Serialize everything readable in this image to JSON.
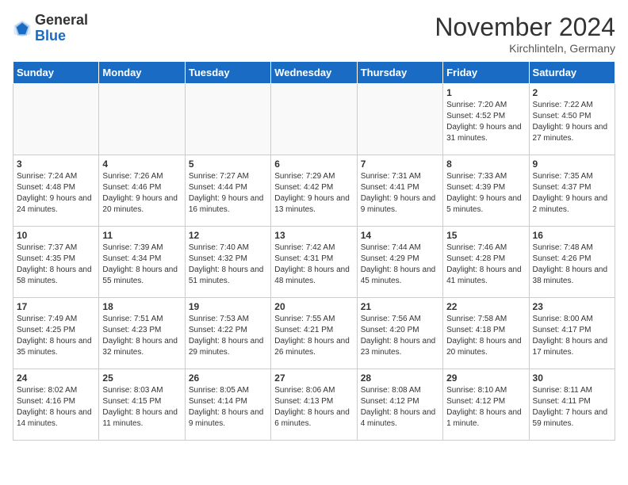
{
  "header": {
    "logo_general": "General",
    "logo_blue": "Blue",
    "month_title": "November 2024",
    "location": "Kirchlinteln, Germany"
  },
  "weekdays": [
    "Sunday",
    "Monday",
    "Tuesday",
    "Wednesday",
    "Thursday",
    "Friday",
    "Saturday"
  ],
  "weeks": [
    [
      {
        "day": "",
        "sunrise": "",
        "sunset": "",
        "daylight": ""
      },
      {
        "day": "",
        "sunrise": "",
        "sunset": "",
        "daylight": ""
      },
      {
        "day": "",
        "sunrise": "",
        "sunset": "",
        "daylight": ""
      },
      {
        "day": "",
        "sunrise": "",
        "sunset": "",
        "daylight": ""
      },
      {
        "day": "",
        "sunrise": "",
        "sunset": "",
        "daylight": ""
      },
      {
        "day": "1",
        "sunrise": "Sunrise: 7:20 AM",
        "sunset": "Sunset: 4:52 PM",
        "daylight": "Daylight: 9 hours and 31 minutes."
      },
      {
        "day": "2",
        "sunrise": "Sunrise: 7:22 AM",
        "sunset": "Sunset: 4:50 PM",
        "daylight": "Daylight: 9 hours and 27 minutes."
      }
    ],
    [
      {
        "day": "3",
        "sunrise": "Sunrise: 7:24 AM",
        "sunset": "Sunset: 4:48 PM",
        "daylight": "Daylight: 9 hours and 24 minutes."
      },
      {
        "day": "4",
        "sunrise": "Sunrise: 7:26 AM",
        "sunset": "Sunset: 4:46 PM",
        "daylight": "Daylight: 9 hours and 20 minutes."
      },
      {
        "day": "5",
        "sunrise": "Sunrise: 7:27 AM",
        "sunset": "Sunset: 4:44 PM",
        "daylight": "Daylight: 9 hours and 16 minutes."
      },
      {
        "day": "6",
        "sunrise": "Sunrise: 7:29 AM",
        "sunset": "Sunset: 4:42 PM",
        "daylight": "Daylight: 9 hours and 13 minutes."
      },
      {
        "day": "7",
        "sunrise": "Sunrise: 7:31 AM",
        "sunset": "Sunset: 4:41 PM",
        "daylight": "Daylight: 9 hours and 9 minutes."
      },
      {
        "day": "8",
        "sunrise": "Sunrise: 7:33 AM",
        "sunset": "Sunset: 4:39 PM",
        "daylight": "Daylight: 9 hours and 5 minutes."
      },
      {
        "day": "9",
        "sunrise": "Sunrise: 7:35 AM",
        "sunset": "Sunset: 4:37 PM",
        "daylight": "Daylight: 9 hours and 2 minutes."
      }
    ],
    [
      {
        "day": "10",
        "sunrise": "Sunrise: 7:37 AM",
        "sunset": "Sunset: 4:35 PM",
        "daylight": "Daylight: 8 hours and 58 minutes."
      },
      {
        "day": "11",
        "sunrise": "Sunrise: 7:39 AM",
        "sunset": "Sunset: 4:34 PM",
        "daylight": "Daylight: 8 hours and 55 minutes."
      },
      {
        "day": "12",
        "sunrise": "Sunrise: 7:40 AM",
        "sunset": "Sunset: 4:32 PM",
        "daylight": "Daylight: 8 hours and 51 minutes."
      },
      {
        "day": "13",
        "sunrise": "Sunrise: 7:42 AM",
        "sunset": "Sunset: 4:31 PM",
        "daylight": "Daylight: 8 hours and 48 minutes."
      },
      {
        "day": "14",
        "sunrise": "Sunrise: 7:44 AM",
        "sunset": "Sunset: 4:29 PM",
        "daylight": "Daylight: 8 hours and 45 minutes."
      },
      {
        "day": "15",
        "sunrise": "Sunrise: 7:46 AM",
        "sunset": "Sunset: 4:28 PM",
        "daylight": "Daylight: 8 hours and 41 minutes."
      },
      {
        "day": "16",
        "sunrise": "Sunrise: 7:48 AM",
        "sunset": "Sunset: 4:26 PM",
        "daylight": "Daylight: 8 hours and 38 minutes."
      }
    ],
    [
      {
        "day": "17",
        "sunrise": "Sunrise: 7:49 AM",
        "sunset": "Sunset: 4:25 PM",
        "daylight": "Daylight: 8 hours and 35 minutes."
      },
      {
        "day": "18",
        "sunrise": "Sunrise: 7:51 AM",
        "sunset": "Sunset: 4:23 PM",
        "daylight": "Daylight: 8 hours and 32 minutes."
      },
      {
        "day": "19",
        "sunrise": "Sunrise: 7:53 AM",
        "sunset": "Sunset: 4:22 PM",
        "daylight": "Daylight: 8 hours and 29 minutes."
      },
      {
        "day": "20",
        "sunrise": "Sunrise: 7:55 AM",
        "sunset": "Sunset: 4:21 PM",
        "daylight": "Daylight: 8 hours and 26 minutes."
      },
      {
        "day": "21",
        "sunrise": "Sunrise: 7:56 AM",
        "sunset": "Sunset: 4:20 PM",
        "daylight": "Daylight: 8 hours and 23 minutes."
      },
      {
        "day": "22",
        "sunrise": "Sunrise: 7:58 AM",
        "sunset": "Sunset: 4:18 PM",
        "daylight": "Daylight: 8 hours and 20 minutes."
      },
      {
        "day": "23",
        "sunrise": "Sunrise: 8:00 AM",
        "sunset": "Sunset: 4:17 PM",
        "daylight": "Daylight: 8 hours and 17 minutes."
      }
    ],
    [
      {
        "day": "24",
        "sunrise": "Sunrise: 8:02 AM",
        "sunset": "Sunset: 4:16 PM",
        "daylight": "Daylight: 8 hours and 14 minutes."
      },
      {
        "day": "25",
        "sunrise": "Sunrise: 8:03 AM",
        "sunset": "Sunset: 4:15 PM",
        "daylight": "Daylight: 8 hours and 11 minutes."
      },
      {
        "day": "26",
        "sunrise": "Sunrise: 8:05 AM",
        "sunset": "Sunset: 4:14 PM",
        "daylight": "Daylight: 8 hours and 9 minutes."
      },
      {
        "day": "27",
        "sunrise": "Sunrise: 8:06 AM",
        "sunset": "Sunset: 4:13 PM",
        "daylight": "Daylight: 8 hours and 6 minutes."
      },
      {
        "day": "28",
        "sunrise": "Sunrise: 8:08 AM",
        "sunset": "Sunset: 4:12 PM",
        "daylight": "Daylight: 8 hours and 4 minutes."
      },
      {
        "day": "29",
        "sunrise": "Sunrise: 8:10 AM",
        "sunset": "Sunset: 4:12 PM",
        "daylight": "Daylight: 8 hours and 1 minute."
      },
      {
        "day": "30",
        "sunrise": "Sunrise: 8:11 AM",
        "sunset": "Sunset: 4:11 PM",
        "daylight": "Daylight: 7 hours and 59 minutes."
      }
    ]
  ]
}
